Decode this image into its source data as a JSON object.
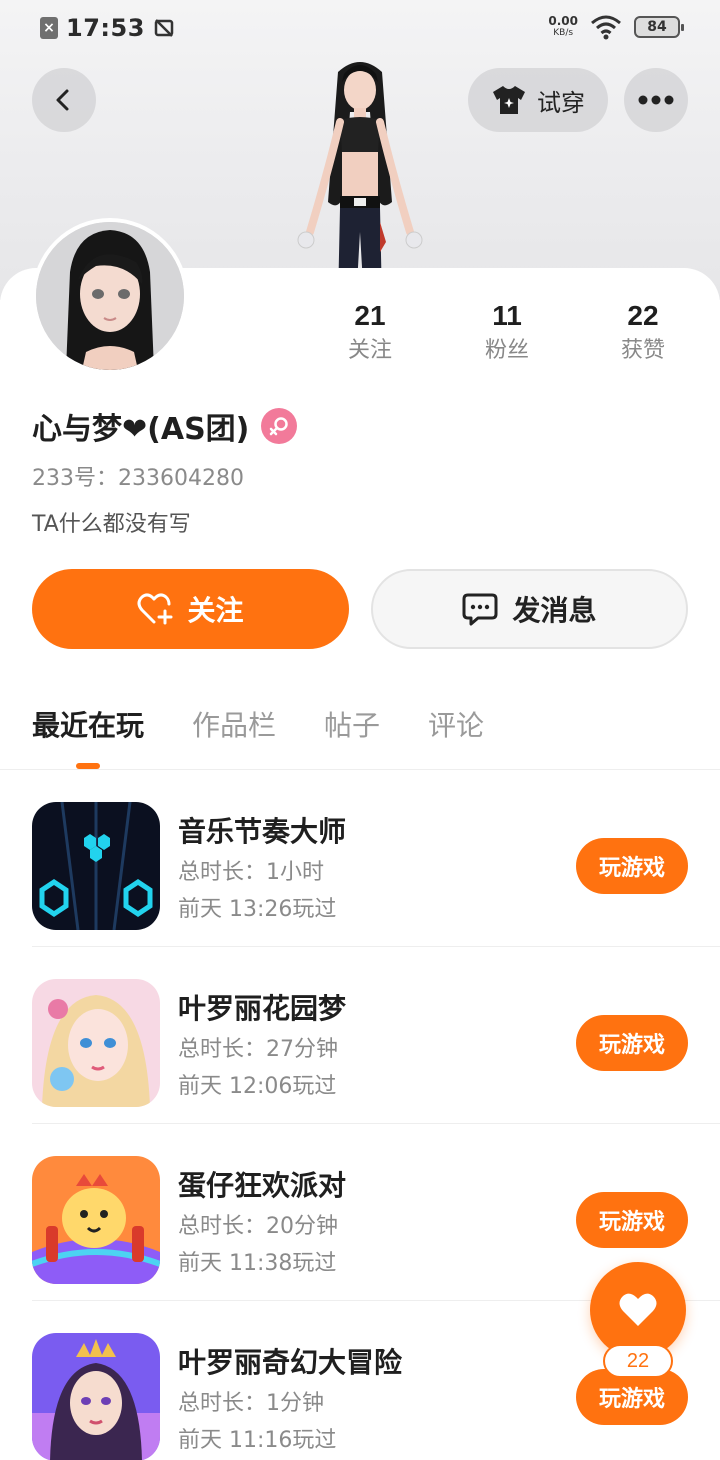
{
  "status_bar": {
    "time": "17:53",
    "net_speed_value": "0.00",
    "net_speed_unit": "KB/s",
    "battery": "84"
  },
  "header": {
    "try_on_label": "试穿"
  },
  "profile": {
    "name": "心与梦❤(AS团)",
    "uid": "233号：233604280",
    "bio": "TA什么都没有写",
    "stats": [
      {
        "value": "21",
        "label": "关注"
      },
      {
        "value": "11",
        "label": "粉丝"
      },
      {
        "value": "22",
        "label": "获赞"
      }
    ]
  },
  "actions": {
    "follow_label": "关注",
    "message_label": "发消息"
  },
  "tabs": [
    {
      "label": "最近在玩",
      "active": true
    },
    {
      "label": "作品栏",
      "active": false
    },
    {
      "label": "帖子",
      "active": false
    },
    {
      "label": "评论",
      "active": false
    }
  ],
  "games": [
    {
      "title": "音乐节奏大师",
      "duration": "总时长：1小时",
      "last_played": "前天 13:26玩过",
      "button": "玩游戏"
    },
    {
      "title": "叶罗丽花园梦",
      "duration": "总时长：27分钟",
      "last_played": "前天 12:06玩过",
      "button": "玩游戏"
    },
    {
      "title": "蛋仔狂欢派对",
      "duration": "总时长：20分钟",
      "last_played": "前天 11:38玩过",
      "button": "玩游戏"
    },
    {
      "title": "叶罗丽奇幻大冒险",
      "duration": "总时长：1分钟",
      "last_played": "前天 11:16玩过",
      "button": "玩游戏"
    }
  ],
  "floating_like": {
    "count": "22"
  },
  "colors": {
    "accent": "#ff7210",
    "gender_badge": "#f27a9a"
  }
}
